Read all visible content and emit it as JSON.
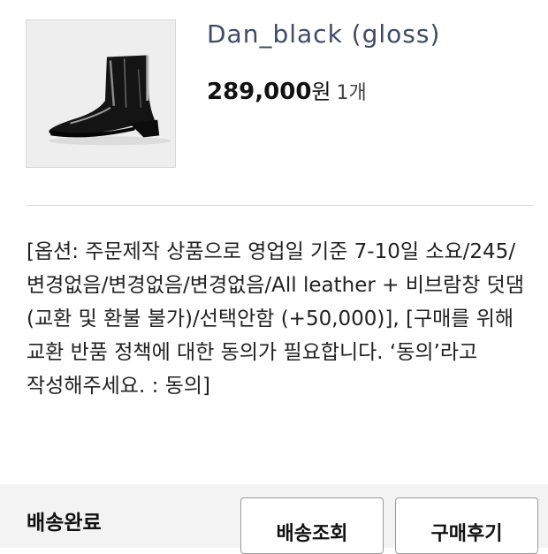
{
  "product": {
    "name": "Dan_black (gloss)",
    "price": "289,000",
    "currency": "원",
    "quantity": "1개"
  },
  "option_text": "[옵션: 주문제작 상품으로 영업일 기준 7-10일 소요/245/변경없음/변경없음/변경없음/All leather + 비브람창 덧댐 (교환 및 환불 불가)/선택안함 (+50,000)], [구매를 위해 교환 반품 정책에 대한 동의가 필요합니다. ‘동의’라고 작성해주세요. : 동의]",
  "footer": {
    "status": "배송완료",
    "track_button": "배송조회",
    "review_button": "구매후기"
  }
}
